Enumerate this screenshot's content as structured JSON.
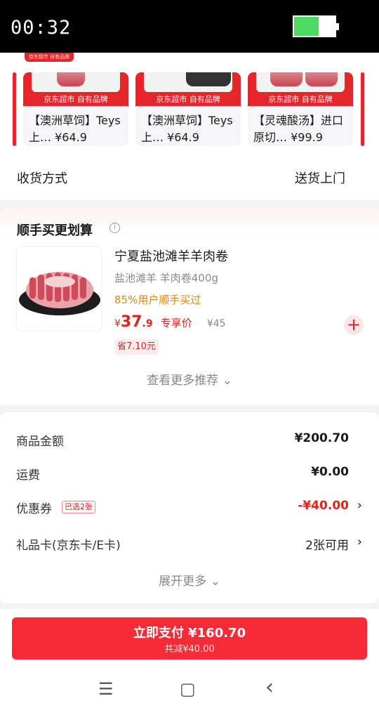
{
  "status_bar": {
    "time": "00:32",
    "battery_level": 0.6
  },
  "top_banner_tag": "京东超市 自有品牌",
  "products": [
    {
      "brand": "京东超市 自有品牌",
      "name": "【澳洲草饲】Teys",
      "name_line2": "上…",
      "price": "¥64.9"
    },
    {
      "brand": "京东超市 自有品牌",
      "name": "【澳洲草饲】Teys",
      "name_line2": "上…",
      "price": "¥64.9"
    },
    {
      "brand": "京东超市 自有品牌",
      "name": "【灵魂酸汤】进口",
      "name_line2": "原切…",
      "price": "¥99.9"
    }
  ],
  "delivery": {
    "label": "收货方式",
    "value": "送货上门"
  },
  "recommend": {
    "title": "顺手买更划算",
    "info_icon": "ⓘ",
    "product_name": "宁夏盐池滩羊羊肉卷",
    "spec": "盐池滩羊 羊肉卷400g",
    "social_proof": "85%用户顺手买过",
    "price_currency": "¥",
    "price_int": "37",
    "price_dec": ".9",
    "price_tag": "专享价",
    "original_price": "¥45",
    "save": "省7.10元",
    "add_icon": "+",
    "more_label": "查看更多推荐 ⌄"
  },
  "summary": {
    "goods_label": "商品金额",
    "goods_value": "¥200.70",
    "shipping_label": "运费",
    "shipping_value": "¥0.00",
    "coupon_label": "优惠券",
    "coupon_badge": "已选2张",
    "coupon_value": "-¥40.00",
    "giftcard_label": "礼品卡(京东卡/E卡)",
    "giftcard_value": "2张可用",
    "chevron": "›",
    "expand_label": "展开更多 ⌄"
  },
  "pay": {
    "main": "立即支付 ¥160.70",
    "sub": "共减¥40.00"
  },
  "nav": {
    "menu": "☰",
    "home": "▢",
    "back": "‹"
  }
}
